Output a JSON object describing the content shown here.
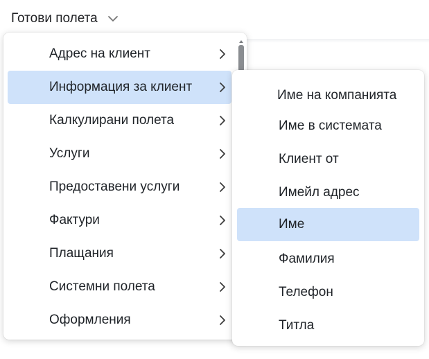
{
  "trigger": {
    "label": "Готови полета"
  },
  "primary_menu": {
    "items": [
      {
        "label": "Адрес на клиент"
      },
      {
        "label": "Информация за клиент"
      },
      {
        "label": "Калкулирани полета"
      },
      {
        "label": "Услуги"
      },
      {
        "label": "Предоставени услуги"
      },
      {
        "label": "Фактури"
      },
      {
        "label": "Плащания"
      },
      {
        "label": "Системни полета"
      },
      {
        "label": "Оформления"
      }
    ],
    "active_index": 1
  },
  "sub_menu": {
    "items": [
      {
        "label": "Име на компанията"
      },
      {
        "label": "Име в системата"
      },
      {
        "label": "Клиент от"
      },
      {
        "label": "Имейл адрес"
      },
      {
        "label": "Име"
      },
      {
        "label": "Фамилия"
      },
      {
        "label": "Телефон"
      },
      {
        "label": "Титла"
      }
    ],
    "active_index": 4
  },
  "colors": {
    "highlight": "#cfe2fa",
    "text": "#1f2328",
    "scrollbar": "#8a8d91"
  },
  "icons": {
    "trigger": "chevron-down-icon",
    "submenu_arrow": "chevron-right-icon",
    "scroll_up": "triangle-up-icon"
  }
}
